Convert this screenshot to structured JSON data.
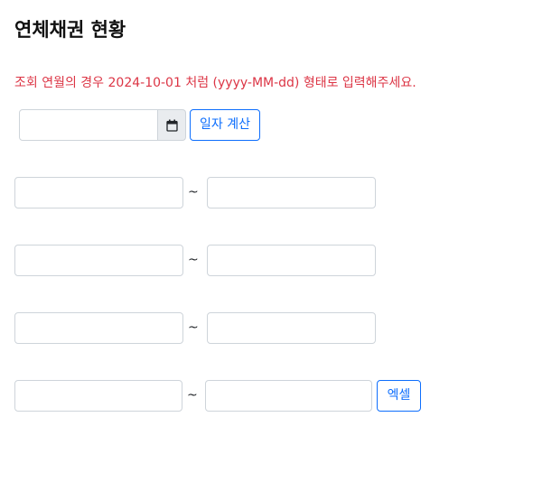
{
  "header": {
    "title": "연체채권 현황"
  },
  "notice": {
    "text": "조회 연월의 경우 2024-10-01 처럼 (yyyy-MM-dd) 형태로 입력해주세요."
  },
  "date_picker": {
    "value": "",
    "placeholder": "",
    "icon": "calendar-icon"
  },
  "buttons": {
    "calc_label": "일자 계산",
    "excel_label": "엑셀"
  },
  "ranges": [
    {
      "from": "",
      "separator": "~",
      "to": ""
    },
    {
      "from": "",
      "separator": "~",
      "to": ""
    },
    {
      "from": "",
      "separator": "~",
      "to": ""
    },
    {
      "from": "",
      "separator": "~",
      "to": ""
    }
  ],
  "colors": {
    "notice": "#dc3545",
    "accent": "#0d6efd",
    "border": "#ced4da",
    "addon_bg": "#e9ecef"
  }
}
